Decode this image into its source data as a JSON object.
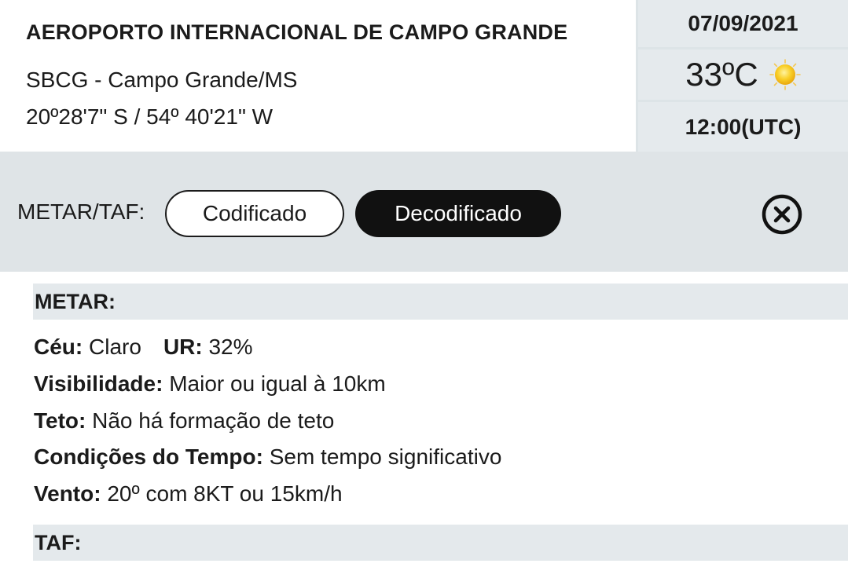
{
  "airport": {
    "name": "AEROPORTO INTERNACIONAL DE CAMPO GRANDE",
    "code_city": "SBCG - Campo Grande/MS",
    "coordinates": "20º28'7\" S / 54º 40'21\" W"
  },
  "weather_panel": {
    "date": "07/09/2021",
    "temperature": "33ºC",
    "weather_icon": "sun-icon",
    "time": "12:00(UTC)"
  },
  "toggle": {
    "label": "METAR/TAF:",
    "options": [
      "Codificado",
      "Decodificado"
    ],
    "selected": "Decodificado"
  },
  "close_icon": "close-circle-icon",
  "metar": {
    "title": "METAR:",
    "ceu_label": "Céu:",
    "ceu_value": "Claro",
    "ur_label": "UR:",
    "ur_value": "32%",
    "visibilidade_label": "Visibilidade:",
    "visibilidade_value": "Maior ou igual à 10km",
    "teto_label": "Teto:",
    "teto_value": "Não há formação de teto",
    "condicoes_label": "Condições do Tempo:",
    "condicoes_value": "Sem tempo significativo",
    "vento_label": "Vento:",
    "vento_value": "20º com 8KT ou 15km/h"
  },
  "taf": {
    "title": "TAF:"
  },
  "colors": {
    "panel_bg": "#e5eaed",
    "selected_pill": "#111111",
    "sun": "#f7c51a"
  }
}
